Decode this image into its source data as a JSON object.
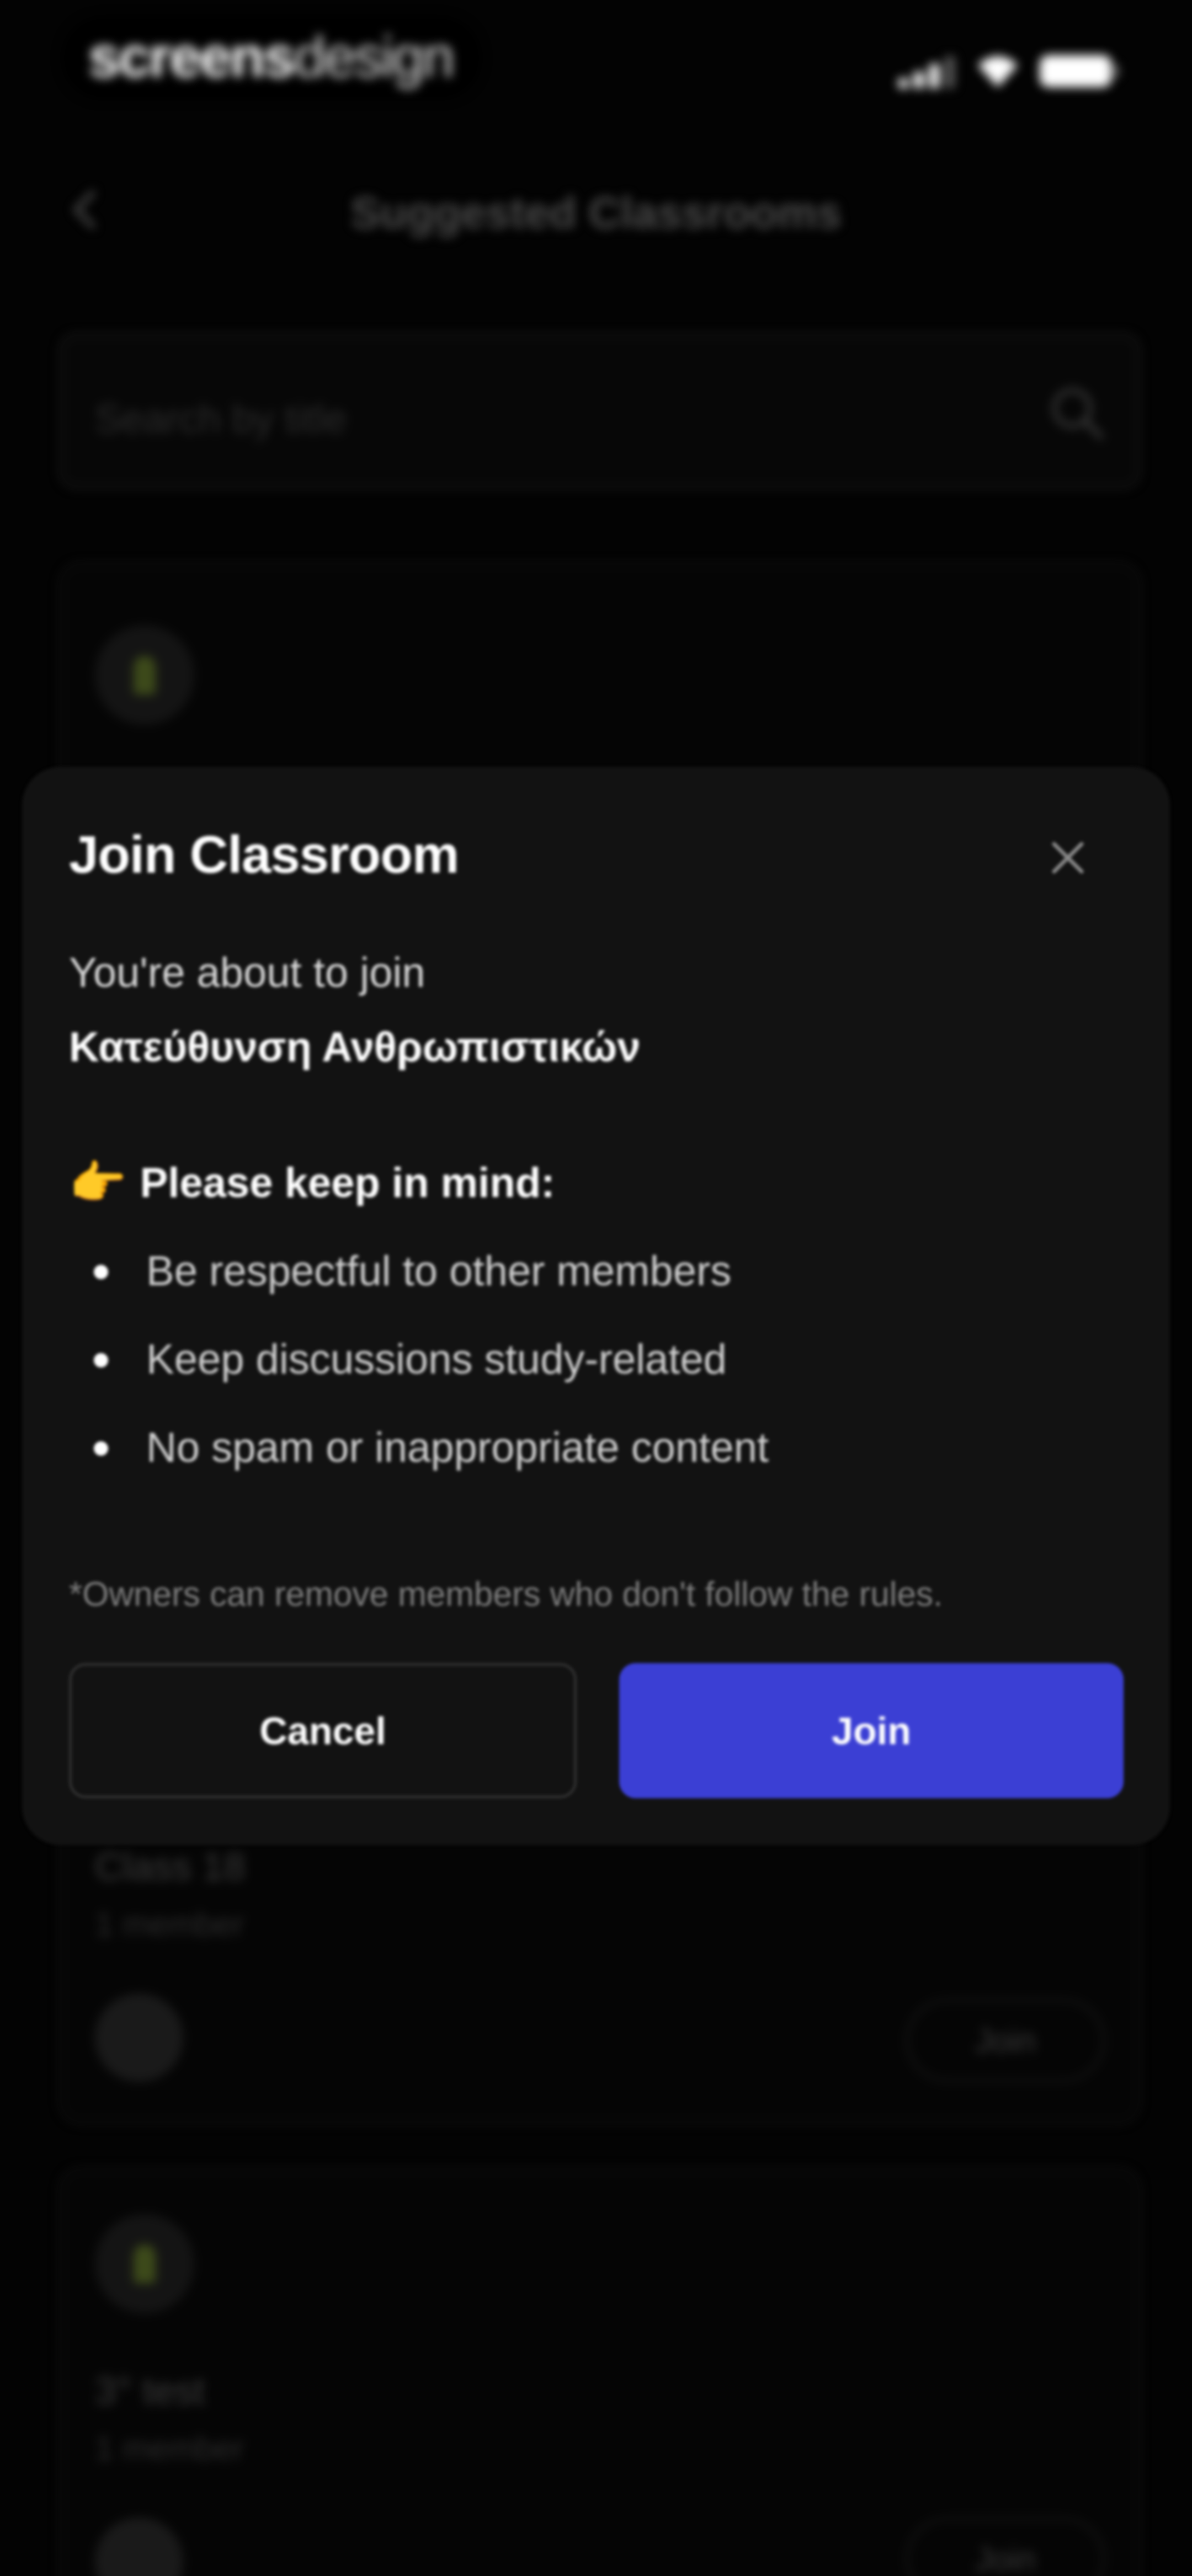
{
  "status_bar": {
    "brand_part1": "screens",
    "brand_part2": "design"
  },
  "header": {
    "title": "Suggested Classrooms",
    "back_icon": "chevron-left-icon"
  },
  "search": {
    "placeholder": "Search by title",
    "icon": "search-icon"
  },
  "cards": [
    {
      "title": "Class 18",
      "members": "1 member",
      "join_label": "Join"
    },
    {
      "title": "3° test",
      "members": "1 member",
      "join_label": "Join"
    }
  ],
  "dialog": {
    "title": "Join Classroom",
    "intro": "You're about to join",
    "classroom_name": "Κατεύθυνση Ανθρωπιστικών",
    "notice_icon": "👉",
    "notice_label": "Please keep in mind:",
    "rules": [
      "Be respectful to other members",
      "Keep discussions study-related",
      "No spam or inappropriate content"
    ],
    "footnote": "*Owners can remove members who don't follow the rules.",
    "cancel_label": "Cancel",
    "join_label": "Join",
    "join_color": "#3b3fd4"
  }
}
